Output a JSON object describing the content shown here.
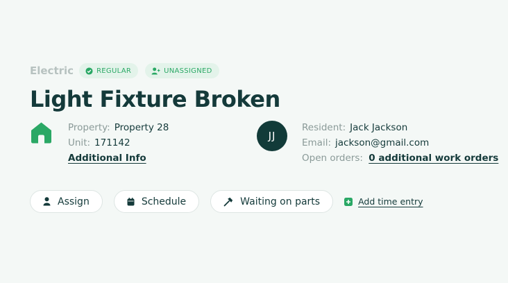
{
  "ticket": {
    "category": "Electric",
    "badges": [
      {
        "label": "REGULAR",
        "icon": "check-badge-icon"
      },
      {
        "label": "UNASSIGNED",
        "icon": "user-add-icon"
      }
    ],
    "title": "Light Fixture Broken"
  },
  "property": {
    "icon": "house-icon",
    "property_label": "Property:",
    "property_value": "Property 28",
    "unit_label": "Unit:",
    "unit_value": "171142",
    "additional_info": "Additional Info"
  },
  "resident": {
    "initials": "JJ",
    "resident_label": "Resident:",
    "resident_value": "Jack Jackson",
    "email_label": "Email:",
    "email_value": "jackson@gmail.com",
    "orders_label": "Open orders:",
    "orders_value": "0 additional work orders"
  },
  "actions": {
    "assign": "Assign",
    "schedule": "Schedule",
    "waiting": "Waiting on parts",
    "add_time": "Add time entry"
  },
  "colors": {
    "accent": "#2aa865",
    "dark": "#143a3a",
    "avatar_bg": "#123b39",
    "background": "#f4f8f6"
  }
}
